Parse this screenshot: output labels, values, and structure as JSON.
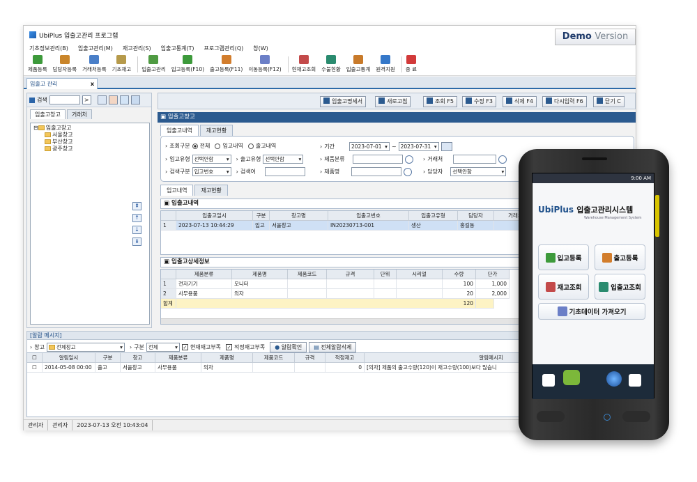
{
  "window": {
    "title": "UbiPlus 입출고관리 프로그램",
    "min": "—",
    "max": "☐",
    "close": "✕"
  },
  "menu": [
    "기초정보관리(B)",
    "입출고관리(M)",
    "재고관리(S)",
    "입출고통계(T)",
    "프로그램관리(Q)",
    "창(W)"
  ],
  "toolbar": [
    {
      "label": "제품등록",
      "color": "#3d9a3b"
    },
    {
      "label": "담당자등록",
      "color": "#c9852a"
    },
    {
      "label": "거래처등록",
      "color": "#4a7fc8"
    },
    {
      "label": "기초재고",
      "color": "#b69a4b"
    },
    {
      "label": "입출고관리",
      "color": "#4f9b42"
    },
    {
      "label": "입고등록(F10)",
      "color": "#3d9a3b"
    },
    {
      "label": "출고등록(F11)",
      "color": "#d27d2c"
    },
    {
      "label": "이동등록(F12)",
      "color": "#6b7fc7"
    },
    {
      "label": "현재고조회",
      "color": "#c34a4a"
    },
    {
      "label": "수불현황",
      "color": "#2a8b6f"
    },
    {
      "label": "입출고통계",
      "color": "#c87a2a"
    },
    {
      "label": "원격지원",
      "color": "#3578c9"
    },
    {
      "label": "종 료",
      "color": "#d23a3a"
    }
  ],
  "demo": {
    "bold": "Demo",
    "light": "Version"
  },
  "doc_tab": {
    "label": "입출고 관리",
    "close": "x"
  },
  "left": {
    "search_label": "검색",
    "go": ">",
    "tabs": [
      "입출고창고",
      "거래처"
    ],
    "tree": {
      "root": "입출고창고",
      "children": [
        "서울창고",
        "부산창고",
        "광주창고"
      ]
    },
    "arrows": [
      "⇞",
      "↑",
      "↓",
      "⇟"
    ]
  },
  "actions": [
    {
      "label": "입출고명세서",
      "icon_color": "#2b5a8f"
    },
    {
      "label": "새로고침",
      "icon_color": "#2b5a8f"
    },
    {
      "label": "조회 F5",
      "icon_color": "#2b5a8f"
    },
    {
      "label": "수정 F3",
      "icon_color": "#2b5a8f"
    },
    {
      "label": "삭제 F4",
      "icon_color": "#2b5a8f"
    },
    {
      "label": "다시입력 F6",
      "icon_color": "#2b5a8f"
    },
    {
      "label": "닫기 C",
      "icon_color": "#2b5a8f"
    }
  ],
  "panel_title": "입출고창고",
  "main_tabs": [
    "입출고내역",
    "재고현황"
  ],
  "filter": {
    "l1": "조회구분",
    "radio": [
      "전체",
      "입고내역",
      "출고내역"
    ],
    "period": "기간",
    "date_from": "2023-07-01",
    "tilde": "~",
    "date_to": "2023-07-31",
    "l2": "입고유형",
    "l2v": "선택안함",
    "l3": "출고유형",
    "l3v": "선택안함",
    "l4": "제품분류",
    "l5": "거래처",
    "l6": "검색구분",
    "l6v": "입고번호",
    "l7": "검색어",
    "l8": "제품명",
    "l9": "담당자",
    "l9v": "선택안함"
  },
  "sub_tabs": [
    "입고내역",
    "재고현황"
  ],
  "list": {
    "title": "입출고내역",
    "headers": [
      "입출고일시",
      "구분",
      "창고명",
      "입출고번호",
      "입출고유형",
      "담당자",
      "거래처"
    ],
    "rows": [
      {
        "no": "1",
        "cells": [
          "2023-07-13 10:44:29",
          "입고",
          "서울창고",
          "IN20230713-001",
          "생산",
          "홍길동",
          ""
        ]
      }
    ]
  },
  "detail": {
    "title": "입출고상세정보",
    "headers": [
      "제품분류",
      "제품명",
      "제품코드",
      "규격",
      "단위",
      "시리얼",
      "수량",
      "단가"
    ],
    "rows": [
      {
        "no": "1",
        "cells": [
          "전자기기",
          "모니터",
          "",
          "",
          "",
          "",
          "100",
          "1,000"
        ]
      },
      {
        "no": "2",
        "cells": [
          "사무용품",
          "의자",
          "",
          "",
          "",
          "",
          "20",
          "2,000"
        ]
      }
    ],
    "total_label": "합계",
    "total_qty": "120"
  },
  "alarm": {
    "title": "[알람 메시지]",
    "wh_label": "창고",
    "wh_value": "전체창고",
    "type_label": "구분",
    "type_value": "전체",
    "chk1": "현재재고부족",
    "chk2": "적정재고부족",
    "btn1": "알람확인",
    "btn2": "전체알람삭제",
    "headers": [
      "알림일시",
      "구분",
      "창고",
      "제품분류",
      "제품명",
      "제품코드",
      "규격",
      "적정재고",
      "알림메시지"
    ],
    "rows": [
      [
        "2014-05-08 00:00",
        "출고",
        "서울창고",
        "사무용품",
        "의자",
        "",
        "",
        "0",
        "[의자] 제품의 출고수량(120)이 재고수량(100)보다 많습니"
      ]
    ]
  },
  "status": [
    "관리자",
    "관리자",
    "2023-07-13 오전 10:43:04"
  ],
  "phone": {
    "time": "9:00 AM",
    "brand": "UbiPlus",
    "app": "입출고관리시스템",
    "sub": "Warehouse Management System",
    "buttons": [
      "입고등록",
      "출고등록",
      "재고조회",
      "입출고조회"
    ],
    "wide": "기초데이터 가져오기"
  }
}
